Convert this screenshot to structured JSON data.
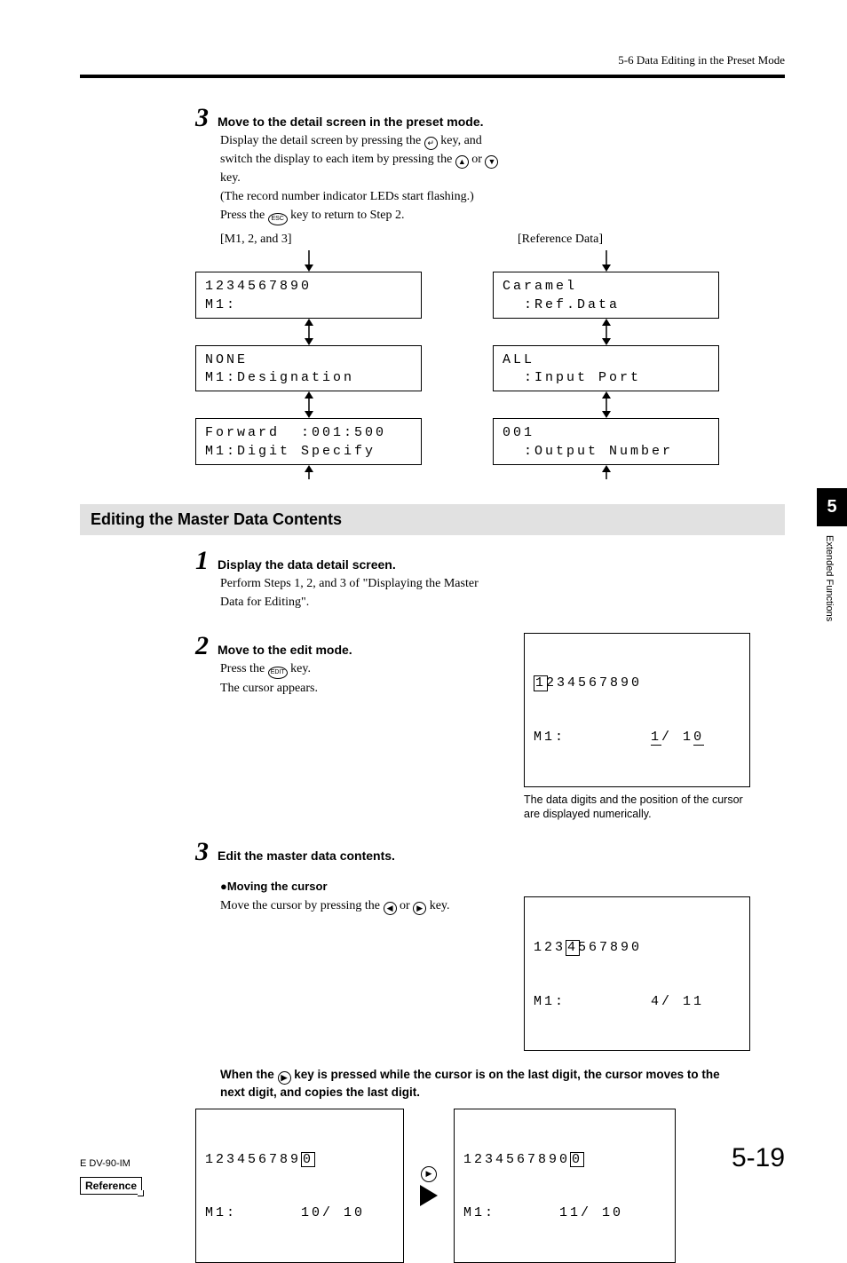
{
  "header": {
    "section": "5-6 Data Editing in the Preset Mode"
  },
  "side_tab": {
    "chapter": "5",
    "label": "Extended Functions"
  },
  "step3top": {
    "num": "3",
    "title": "Move to the detail screen in the preset mode.",
    "body_pre": "Display the detail screen by pressing the ",
    "body_mid1": " key, and switch the display to each item by pressing the ",
    "body_mid2": " or ",
    "body_post": " key.",
    "note": "(The record number indicator LEDs start flashing.)",
    "press_pre": "Press the ",
    "press_post": " key to return to Step 2.",
    "label_left": "[M1, 2, and 3]",
    "label_right": "[Reference Data]"
  },
  "lcd_left": {
    "box1_l1": "1234567890",
    "box1_l2": "M1:",
    "box2_l1": "NONE",
    "box2_l2": "M1:Designation",
    "box3_l1": "Forward  :001:500",
    "box3_l2": "M1:Digit Specify"
  },
  "lcd_right": {
    "box1_l1": "Caramel",
    "box1_l2": "  :Ref.Data",
    "box2_l1": "ALL",
    "box2_l2": "  :Input Port",
    "box3_l1": "001",
    "box3_l2": "  :Output Number"
  },
  "section_title": "Editing the Master Data Contents",
  "step1": {
    "num": "1",
    "title": "Display the data detail screen.",
    "body": "Perform Steps 1, 2, and 3 of \"Displaying the Master Data for Editing\"."
  },
  "step2": {
    "num": "2",
    "title": "Move to the edit mode.",
    "body_pre": "Press the ",
    "body_post": " key.",
    "body2": "The cursor appears.",
    "lcd_l1_pre": "",
    "lcd_l1_hl": "1",
    "lcd_l1_post": "234567890",
    "lcd_l2": "M1:        1/ 10",
    "caption": "The data digits and the position of the cursor are displayed numerically."
  },
  "step3": {
    "num": "3",
    "title": "Edit the master data contents.",
    "subhead": "●Moving the cursor",
    "body_pre": "Move the cursor by pressing the ",
    "body_mid": " or ",
    "body_post": " key.",
    "lcd_l1_pre": "123",
    "lcd_l1_hl": "4",
    "lcd_l1_post": "567890",
    "lcd_l2": "M1:        4/ 11"
  },
  "note_bold_pre": "When the ",
  "note_bold_post": " key is pressed while the cursor is on the last digit, the cursor moves to the next digit, and copies the last digit.",
  "reference": {
    "label": "Reference",
    "lcdA_l1_pre": "123456789",
    "lcdA_l1_hl": "0",
    "lcdA_l2": "M1:      10/ 10",
    "lcdB_l1_pre": "1234567890",
    "lcdB_l1_hl": "0",
    "lcdB_l2": "M1:      11/ 10"
  },
  "footer": {
    "code": "E DV-90-IM",
    "page": "5-19"
  },
  "icons": {
    "enter": "↵",
    "up": "▲",
    "down": "▼",
    "left": "◀",
    "right": "▶",
    "esc": "ESC",
    "edit": "EDIT"
  }
}
